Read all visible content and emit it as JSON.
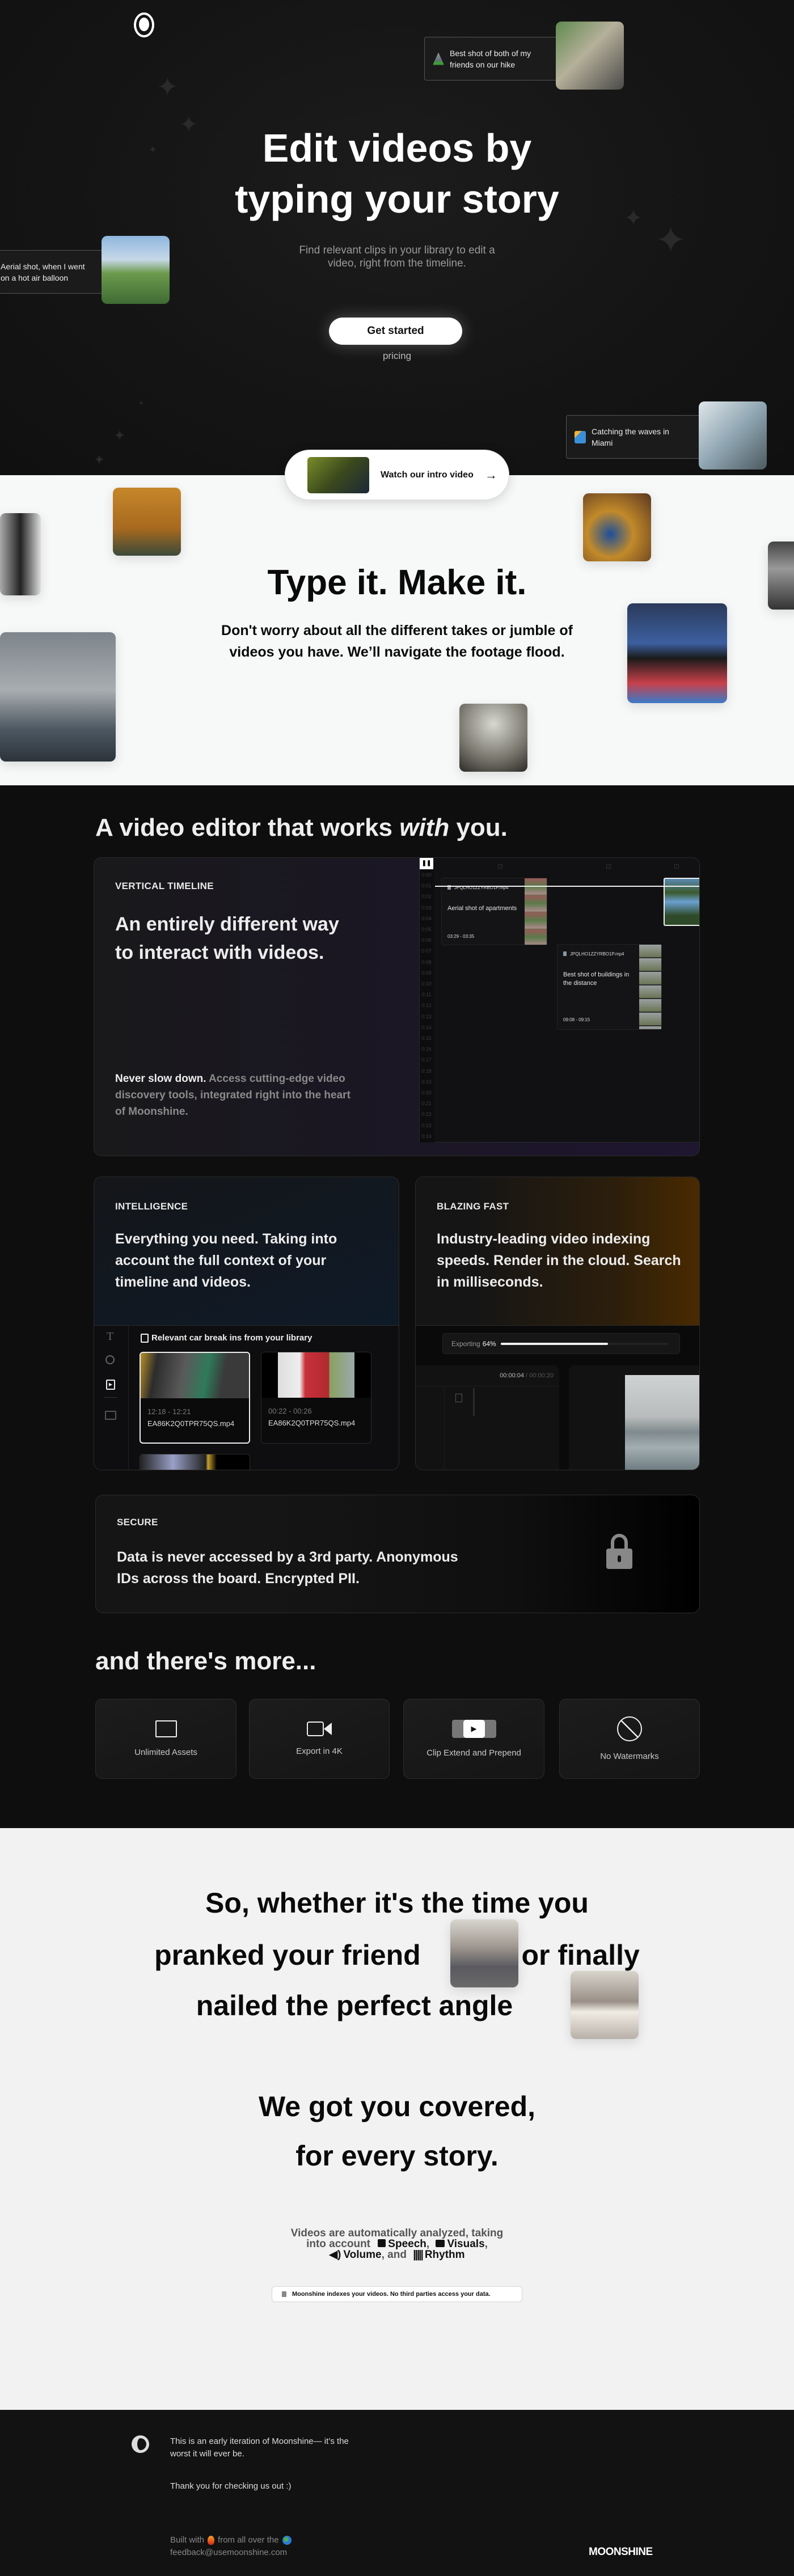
{
  "hero": {
    "title_line1": "Edit videos by",
    "title_line2": "typing your story",
    "subtitle_line1": "Find relevant clips in your library to edit a",
    "subtitle_line2": "video, right from the timeline.",
    "cta_label": "Get started",
    "pricing_label": "pricing",
    "cards": [
      {
        "caption": "Best shot of both of my friends on our hike",
        "icon": "mountain-icon"
      },
      {
        "caption": "Aerial shot, when I went on a hot air balloon",
        "icon": "balloon-icon"
      },
      {
        "caption": "Catching the waves in Miami",
        "icon": "surfer-icon"
      }
    ],
    "watch_label": "Watch our intro video"
  },
  "type_section": {
    "title": "Type it. Make it.",
    "subtitle_line1": "Don't worry about all the different takes or jumble of",
    "subtitle_line2": "videos you have. We’ll navigate the footage flood."
  },
  "features": {
    "heading_pre": "A video editor that works ",
    "heading_em": "with",
    "heading_post": " you.",
    "timeline": {
      "label": "VERTICAL TIMELINE",
      "title_line1": "An entirely different way",
      "title_line2": "to interact with videos.",
      "body_bold": "Never slow down.",
      "body_rest": " Access cutting-edge video discovery tools, integrated right into the heart of Moonshine.",
      "ticks": [
        "0:00",
        "0:01",
        "0:02",
        "0:03",
        "0:04",
        "0:05",
        "0:06",
        "0:07",
        "0:08",
        "0:09",
        "0:10",
        "0:11",
        "0:12",
        "0:13",
        "0:14",
        "0:15",
        "0:16",
        "0:17",
        "0:18",
        "0:19",
        "0:20",
        "0:21",
        "0:22",
        "0:23",
        "0:24"
      ],
      "clips": [
        {
          "file": "JPQLHO1ZZYRBO1P.mp4",
          "desc": "Aerial shot of apartments",
          "time": "03:29 - 03:35"
        },
        {
          "file": "JPQLHO1ZZYRBO1P.mp4",
          "desc": "Best shot of buildings in the distance",
          "time": "09:08 - 09:15"
        }
      ]
    },
    "intelligence": {
      "label": "INTELLIGENCE",
      "body": "Everything you need. Taking into account the full context of your timeline and videos.",
      "panel_header": "Relevant car break ins from your library",
      "clips": [
        {
          "time": "12:18 - 12:21",
          "file": "EA86K2Q0TPR75QS.mp4",
          "selected": true
        },
        {
          "time": "00:22 - 00:26",
          "file": "EA86K2Q0TPR75QS.mp4",
          "selected": false
        }
      ]
    },
    "blazing": {
      "label": "BLAZING FAST",
      "body": "Industry-leading video indexing speeds. Render in the cloud. Search in milliseconds.",
      "export_label": "Exporting",
      "export_percent_label": "64%",
      "export_progress": 0.64,
      "timecode_current": "00:00:04",
      "timecode_total": " / 00:00:20"
    },
    "secure": {
      "label": "SECURE",
      "body_line1": "Data is never accessed by a 3rd party. Anonymous",
      "body_line2": "IDs across the board. Encrypted PII."
    },
    "more": {
      "heading": "and there's more...",
      "items": [
        {
          "label": "Unlimited Assets",
          "icon": "folder-icon"
        },
        {
          "label": "Export in 4K",
          "icon": "video-camera-icon"
        },
        {
          "label": "Clip Extend and Prepend",
          "icon": "clip-extend-icon"
        },
        {
          "label": "No Watermarks",
          "icon": "no-watermark-icon"
        }
      ]
    }
  },
  "story": {
    "line1": "So, whether it's the time you",
    "line2a": "pranked your friend",
    "line2b": ", or finally",
    "line3": "nailed the perfect angle",
    "covered1": "We got you covered,",
    "covered2": "for every story.",
    "analyzed": {
      "pre": "Videos are automatically analyzed, taking",
      "into": "into account",
      "speech": "Speech",
      "visuals": "Visuals",
      "volume": "Volume",
      "and": ", and",
      "rhythm": "Rhythm",
      "comma": ","
    },
    "notice": "Moonshine indexes your videos. No third parties access your data."
  },
  "footer": {
    "line1": "This is an early iteration of Moonshine— it’s the",
    "line2": "worst it will ever be.",
    "thanks": "Thank you for checking us out :)",
    "built_pre": "Built with",
    "built_mid": "from all over the",
    "email": "feedback@usemoonshine.com",
    "wordmark": "MOONSHINE"
  },
  "colors": {
    "hero_bg": "#121212",
    "light_bg": "#f2f2f2",
    "accent_purple": "#1d1629",
    "accent_orange": "#4a2a00"
  }
}
